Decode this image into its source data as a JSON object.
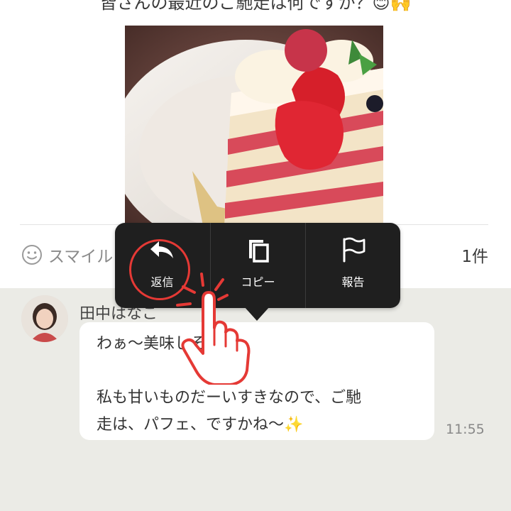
{
  "post": {
    "caption": "皆さんの最近のご馳走は何ですか？😊🙌",
    "photo_icon": "strawberry-shortcake-photo"
  },
  "reactions": {
    "smile_label": "スマイル",
    "count": "1件",
    "icon": "smile-icon"
  },
  "context_menu": {
    "items": [
      {
        "label": "返信",
        "icon": "reply-arrow-icon"
      },
      {
        "label": "コピー",
        "icon": "copy-icon"
      },
      {
        "label": "報告",
        "icon": "flag-icon"
      }
    ]
  },
  "comment": {
    "author": "田中はなこ",
    "lines": [
      "わぁ〜美味しそう！",
      "",
      "私も甘いものだーいすきなので、ご馳",
      "走は、パフェ、ですかね〜✨"
    ],
    "time": "11:55"
  },
  "colors": {
    "menu_bg": "#1f1f1f",
    "highlight_red": "#e53935",
    "comment_area_bg": "#ebebe6"
  }
}
